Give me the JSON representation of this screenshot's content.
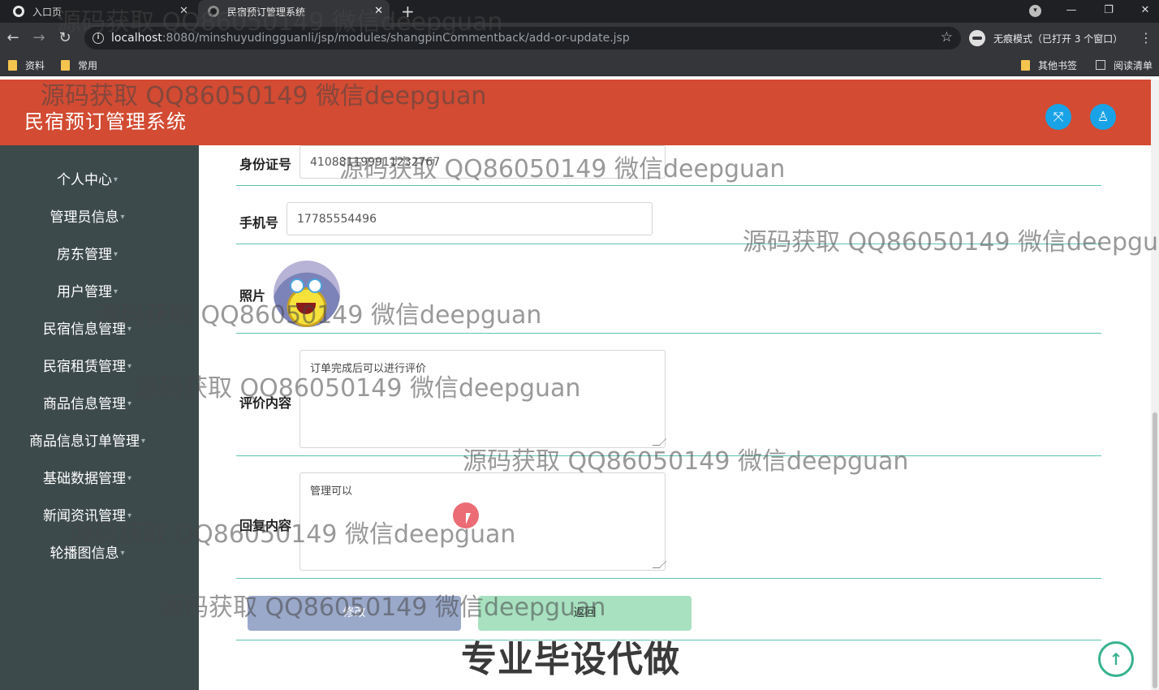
{
  "browser": {
    "tabs": [
      {
        "label": "入口页"
      },
      {
        "label": "民宿预订管理系统"
      }
    ],
    "url_host": "localhost",
    "url_rest": ":8080/minshuyudingguanli/jsp/modules/shangpinCommentback/add-or-update.jsp",
    "incognito_label": "无痕模式（已打开 3 个窗口）",
    "bookmarks": [
      {
        "label": "资料"
      },
      {
        "label": "常用"
      }
    ],
    "other_bookmarks": "其他书签",
    "reading_list": "阅读清单"
  },
  "app": {
    "title": "民宿预订管理系统"
  },
  "sidebar": {
    "items": [
      {
        "label": "个人中心"
      },
      {
        "label": "管理员信息"
      },
      {
        "label": "房东管理"
      },
      {
        "label": "用户管理"
      },
      {
        "label": "民宿信息管理"
      },
      {
        "label": "民宿租赁管理"
      },
      {
        "label": "商品信息管理"
      },
      {
        "label": "商品信息订单管理"
      },
      {
        "label": "基础数据管理"
      },
      {
        "label": "新闻资讯管理"
      },
      {
        "label": "轮播图信息"
      }
    ]
  },
  "form": {
    "id_card_label": "身份证号",
    "id_card_value": "410881199911232767",
    "phone_label": "手机号",
    "phone_value": "17785554496",
    "photo_label": "照片",
    "comment_label": "评价内容",
    "comment_value": "订单完成后可以进行评价",
    "reply_label": "回复内容",
    "reply_value": "管理可以",
    "submit_label": "修改",
    "back_label": "返回"
  },
  "overlay": {
    "watermark": "源码获取 QQ86050149 微信deepguan",
    "promo": "专业毕设代做"
  },
  "colors": {
    "header": "#d24b32",
    "sidebar": "#3d4a4c",
    "accent": "#19a3e6",
    "divider": "#5ec3b0"
  }
}
